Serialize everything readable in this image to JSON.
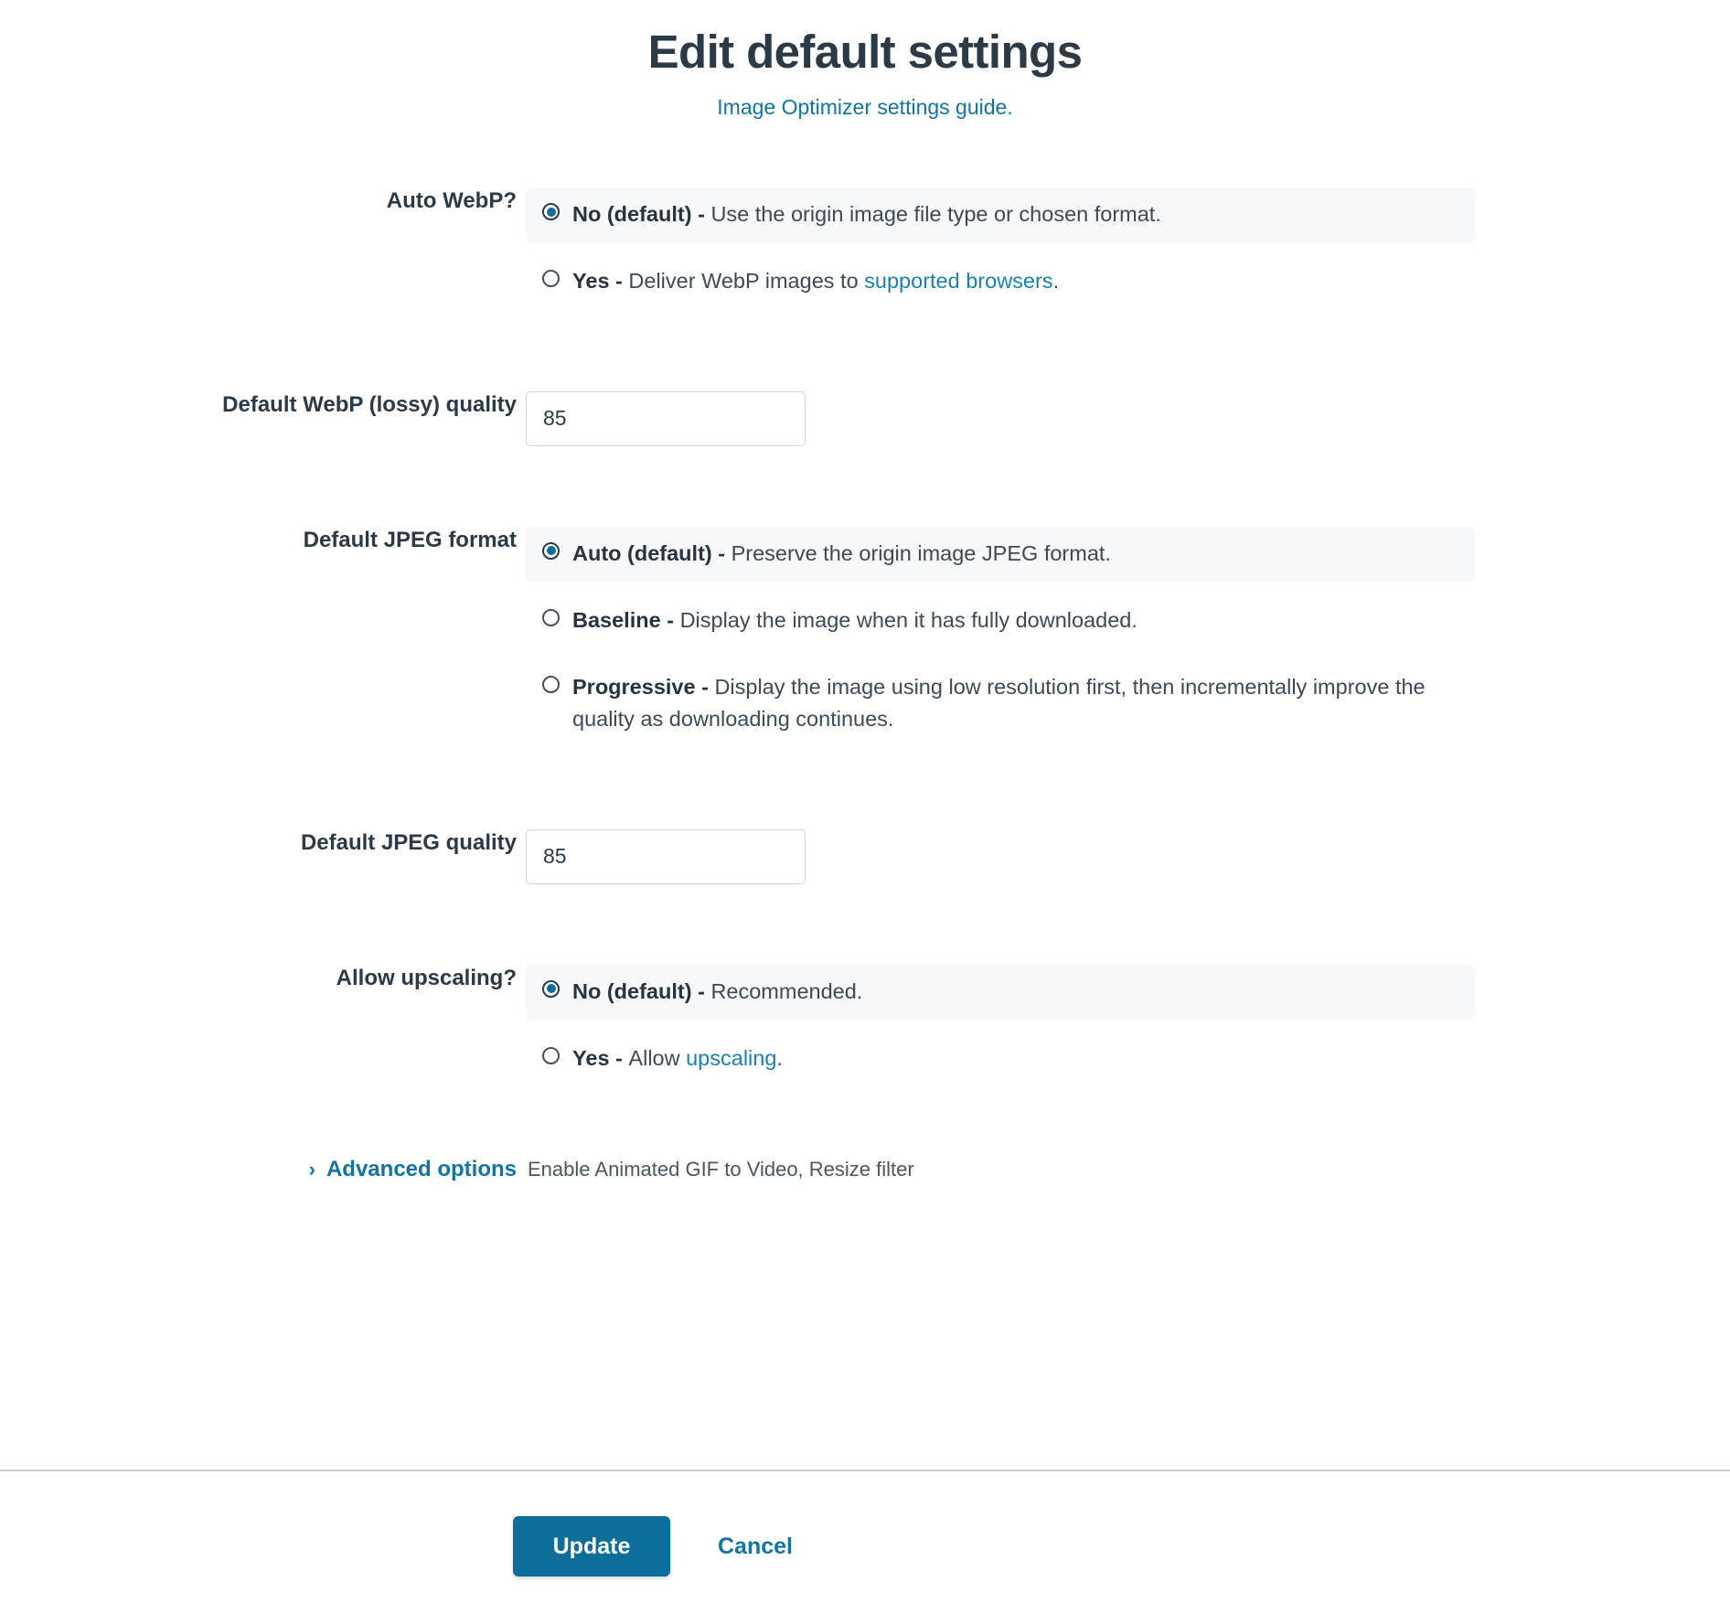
{
  "header": {
    "title": "Edit default settings",
    "subtitle_link": "Image Optimizer settings guide."
  },
  "colors": {
    "accent": "#0d6e99",
    "link": "#12749f",
    "text": "#2b3a47",
    "selected_row_bg": "#f6f8fa",
    "input_border": "#ccd4dc",
    "divider": "#c7cfd7"
  },
  "fields": {
    "auto_webp": {
      "label": "Auto WebP?",
      "options": [
        {
          "selected": true,
          "strong": "No (default)",
          "dash": " - ",
          "text": "Use the origin image file type or chosen format.",
          "link": "",
          "tail": ""
        },
        {
          "selected": false,
          "strong": "Yes",
          "dash": " - ",
          "text": "Deliver WebP images to ",
          "link": "supported browsers",
          "tail": "."
        }
      ]
    },
    "webp_quality": {
      "label": "Default WebP (lossy) quality",
      "value": "85",
      "placeholder": ""
    },
    "jpeg_format": {
      "label": "Default JPEG format",
      "options": [
        {
          "selected": true,
          "strong": "Auto (default)",
          "dash": " - ",
          "text": "Preserve the origin image JPEG format.",
          "link": "",
          "tail": ""
        },
        {
          "selected": false,
          "strong": "Baseline",
          "dash": " - ",
          "text": "Display the image when it has fully downloaded.",
          "link": "",
          "tail": ""
        },
        {
          "selected": false,
          "strong": "Progressive",
          "dash": " - ",
          "text": "Display the image using low resolution first, then incrementally improve the quality as downloading continues.",
          "link": "",
          "tail": ""
        }
      ]
    },
    "jpeg_quality": {
      "label": "Default JPEG quality",
      "value": "85",
      "placeholder": ""
    },
    "allow_upscaling": {
      "label": "Allow upscaling?",
      "options": [
        {
          "selected": true,
          "strong": "No (default)",
          "dash": " - ",
          "text": "Recommended.",
          "link": "",
          "tail": ""
        },
        {
          "selected": false,
          "strong": "Yes",
          "dash": " - ",
          "text": "Allow ",
          "link": "upscaling",
          "tail": "."
        }
      ]
    },
    "advanced": {
      "toggle_label": "Advanced options",
      "chevron": "›",
      "summary": "Enable Animated GIF to Video, Resize filter"
    }
  },
  "footer": {
    "update_label": "Update",
    "cancel_label": "Cancel"
  }
}
